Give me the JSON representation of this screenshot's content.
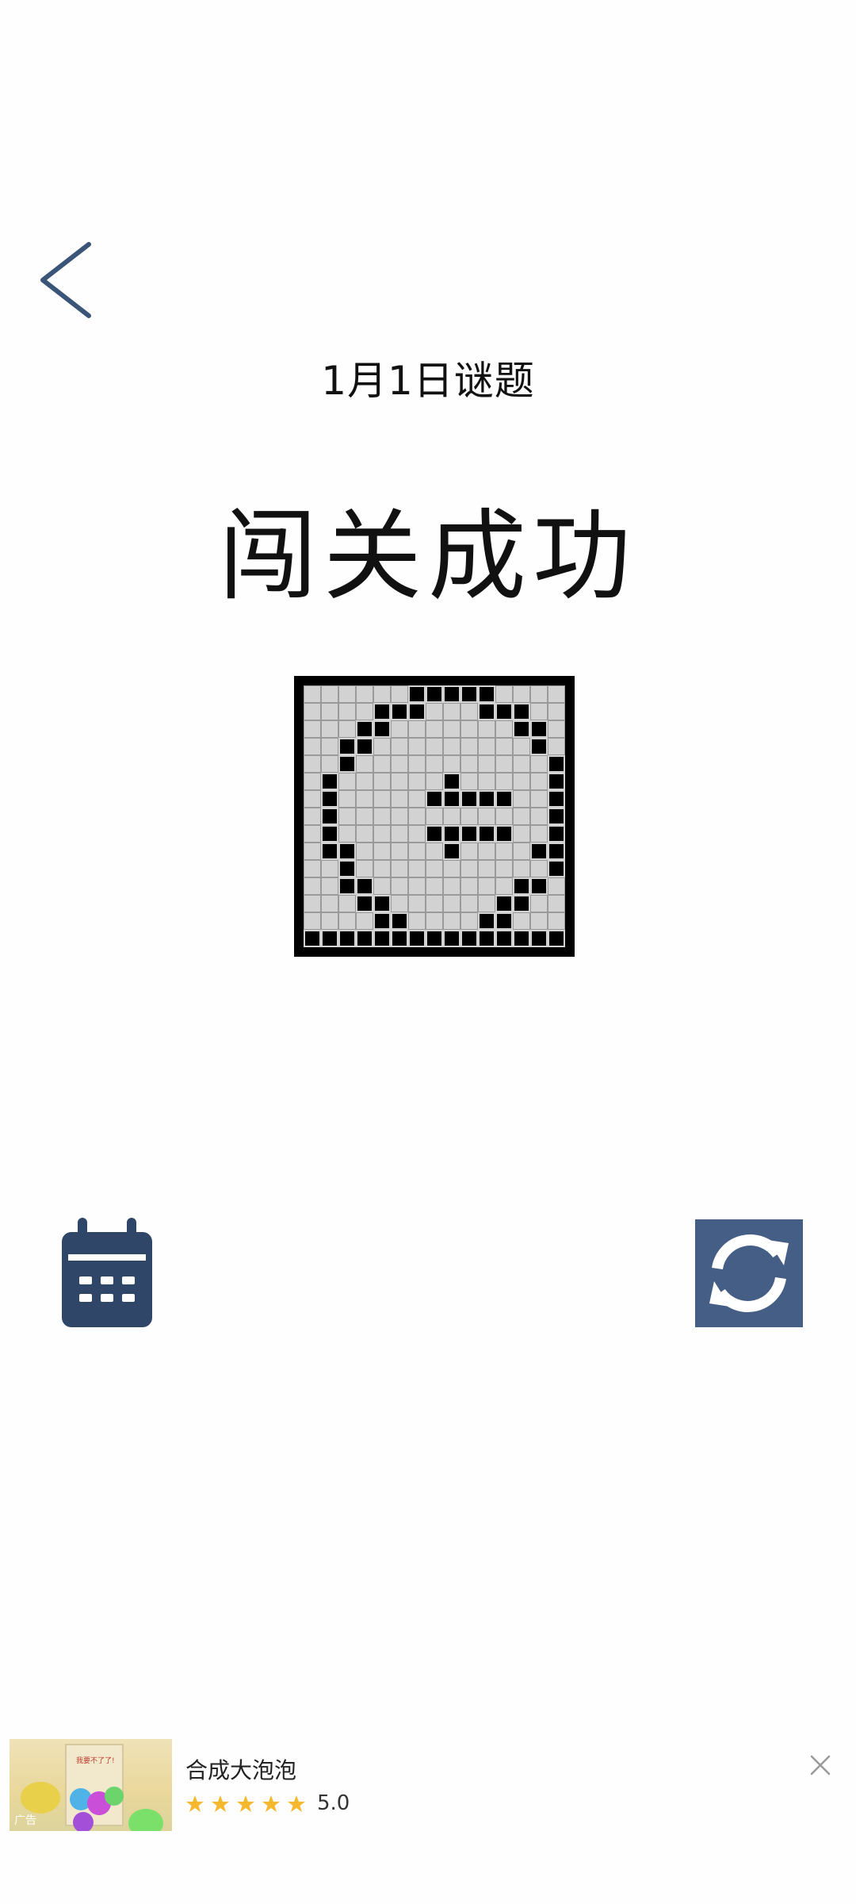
{
  "header": {
    "back_icon": "chevron-left-icon",
    "date_title": "1月1日谜题",
    "success_title": "闯关成功"
  },
  "puzzle": {
    "size": 15,
    "rows": [
      "......#####....",
      "....###...###..",
      "...##.......##.",
      "..##.........#.",
      "..#...........#",
      ".#......#.....#",
      ".#.....#####..#",
      ".#............#",
      ".#.....#####..#",
      ".##.....#....##",
      "..#...........#",
      "..##........##.",
      "...##......##..",
      "....##....##...",
      "###############"
    ]
  },
  "actions": {
    "calendar_icon": "calendar-icon",
    "refresh_icon": "refresh-icon"
  },
  "ad": {
    "title": "合成大泡泡",
    "stars": 5,
    "rating": "5.0",
    "thumb_text": "我要不了了!",
    "tag": "广告",
    "close_icon": "close-icon",
    "star_color": "#f5b82e"
  },
  "colors": {
    "accent": "#445e85",
    "calendar": "#2f4669"
  }
}
